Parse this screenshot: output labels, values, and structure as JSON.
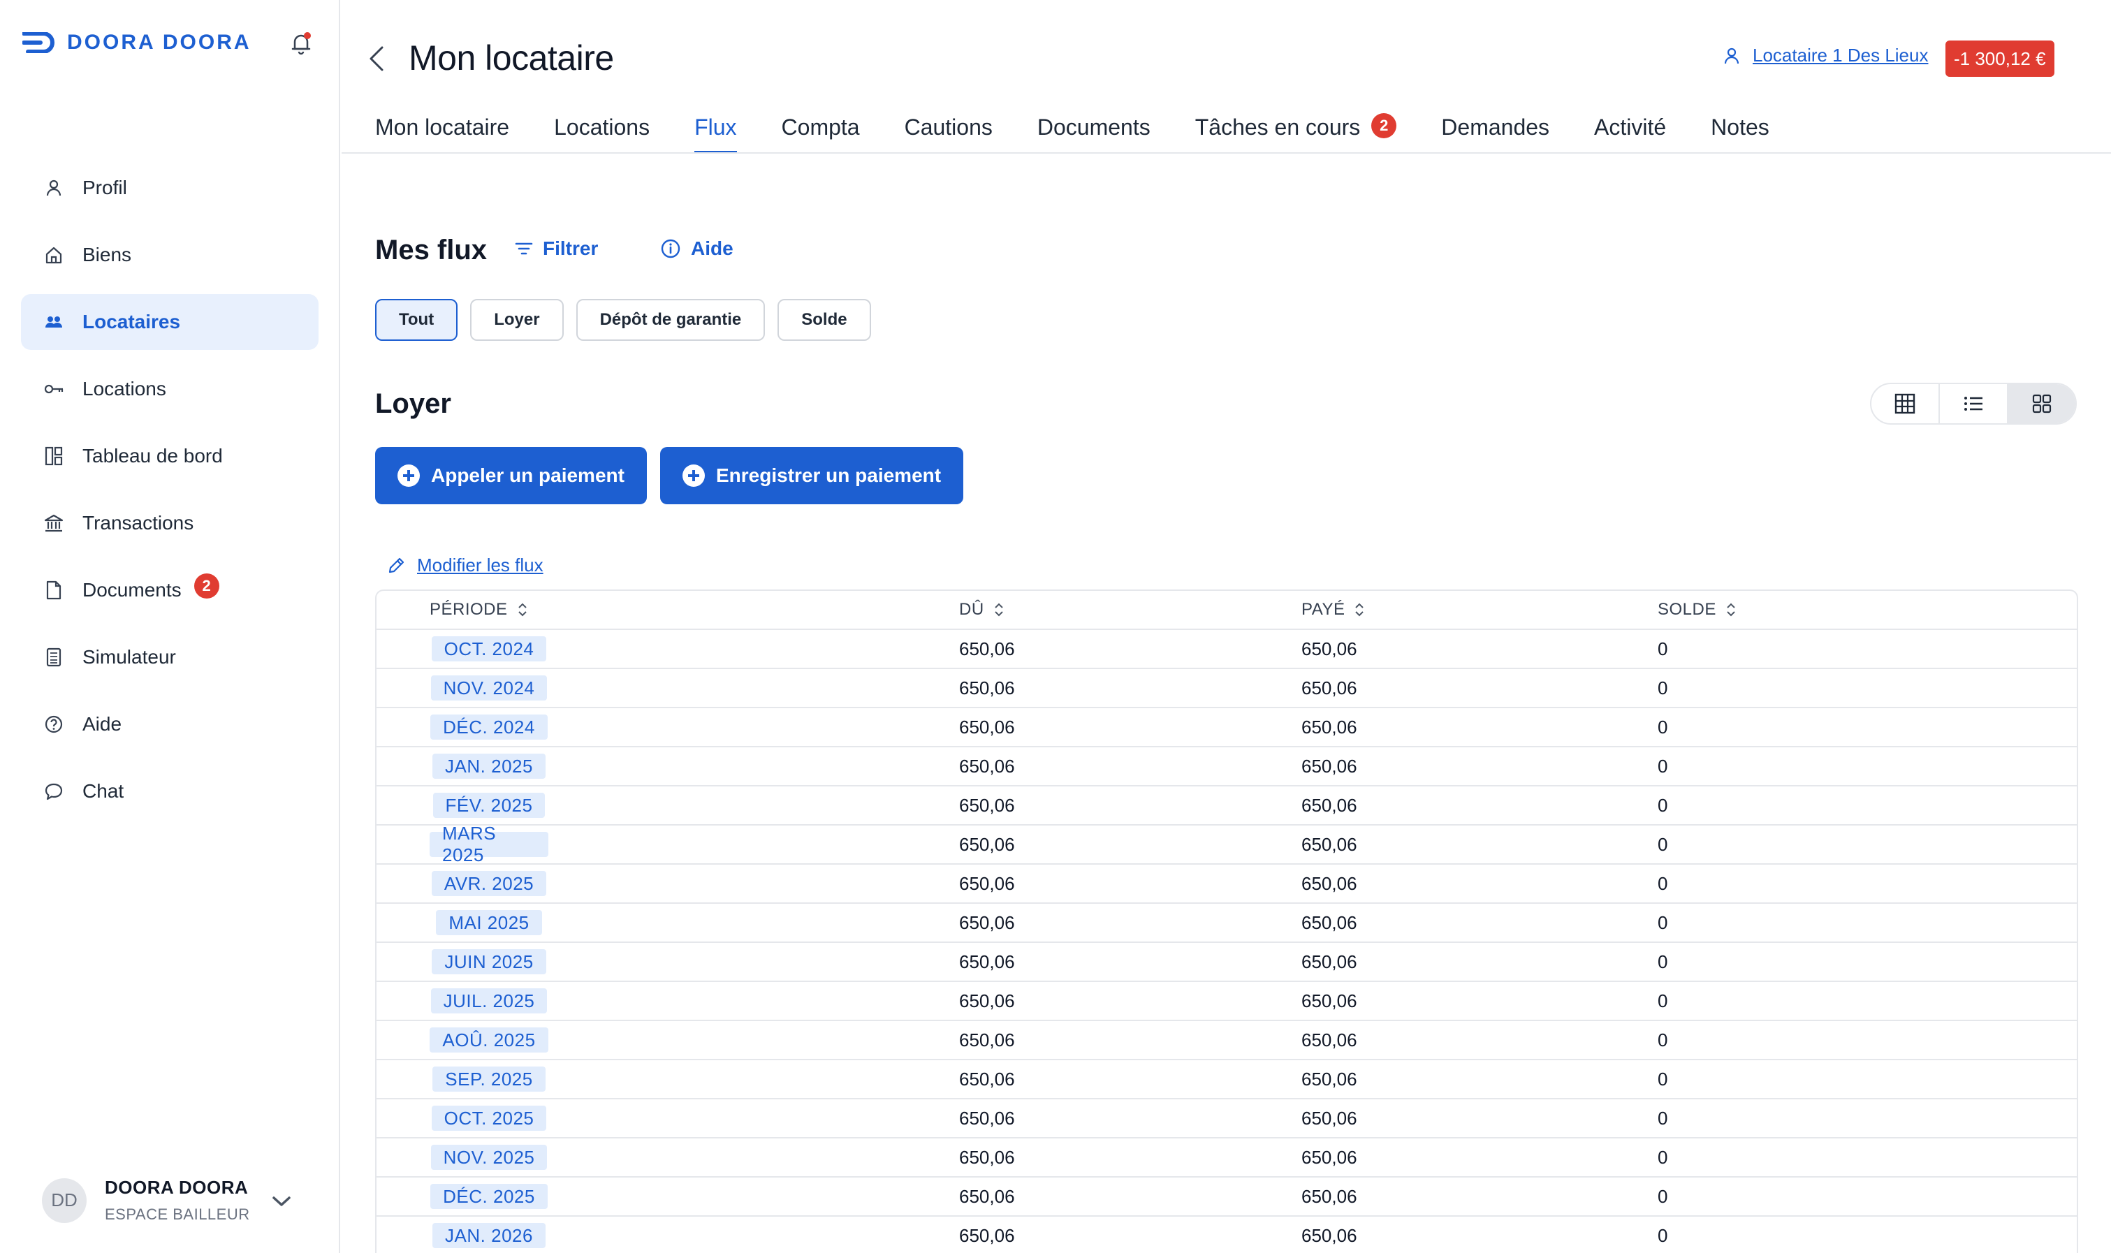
{
  "brand": {
    "name": "DOORA DOORA",
    "color": "#1d5fd1"
  },
  "sidebar": {
    "items": [
      {
        "label": "Profil",
        "icon": "user-icon",
        "active": false
      },
      {
        "label": "Biens",
        "icon": "home-icon",
        "active": false
      },
      {
        "label": "Locataires",
        "icon": "users-icon",
        "active": true
      },
      {
        "label": "Locations",
        "icon": "key-icon",
        "active": false
      },
      {
        "label": "Tableau de bord",
        "icon": "dashboard-icon",
        "active": false
      },
      {
        "label": "Transactions",
        "icon": "bank-icon",
        "active": false
      },
      {
        "label": "Documents",
        "icon": "document-icon",
        "active": false,
        "badge": "2"
      },
      {
        "label": "Simulateur",
        "icon": "calculator-icon",
        "active": false
      },
      {
        "label": "Aide",
        "icon": "help-icon",
        "active": false
      },
      {
        "label": "Chat",
        "icon": "chat-icon",
        "active": false
      }
    ],
    "user": {
      "initials": "DD",
      "name": "DOORA DOORA",
      "role": "ESPACE BAILLEUR"
    }
  },
  "header": {
    "title": "Mon locataire",
    "tenant_link": "Locataire 1 Des Lieux",
    "balance": "-1 300,12 €"
  },
  "tabs": [
    {
      "label": "Mon locataire",
      "active": false
    },
    {
      "label": "Locations",
      "active": false
    },
    {
      "label": "Flux",
      "active": true
    },
    {
      "label": "Compta",
      "active": false
    },
    {
      "label": "Cautions",
      "active": false
    },
    {
      "label": "Documents",
      "active": false
    },
    {
      "label": "Tâches en cours",
      "active": false,
      "badge": "2"
    },
    {
      "label": "Demandes",
      "active": false
    },
    {
      "label": "Activité",
      "active": false
    },
    {
      "label": "Notes",
      "active": false
    }
  ],
  "flux": {
    "title": "Mes flux",
    "filter_label": "Filtrer",
    "help_label": "Aide",
    "chips": [
      {
        "label": "Tout",
        "active": true
      },
      {
        "label": "Loyer",
        "active": false
      },
      {
        "label": "Dépôt de garantie",
        "active": false
      },
      {
        "label": "Solde",
        "active": false
      }
    ],
    "section_title": "Loyer",
    "buttons": {
      "call_payment": "Appeler un paiement",
      "record_payment": "Enregistrer un paiement"
    },
    "edit_link": "Modifier les flux",
    "view_toggle": [
      "table-view-icon",
      "list-view-icon",
      "grid-view-icon"
    ]
  },
  "table": {
    "columns": [
      "PÉRIODE",
      "DÛ",
      "PAYÉ",
      "SOLDE"
    ],
    "rows": [
      {
        "period": "OCT. 2024",
        "du": "650,06",
        "paye": "650,06",
        "solde": "0"
      },
      {
        "period": "NOV. 2024",
        "du": "650,06",
        "paye": "650,06",
        "solde": "0"
      },
      {
        "period": "DÉC. 2024",
        "du": "650,06",
        "paye": "650,06",
        "solde": "0"
      },
      {
        "period": "JAN. 2025",
        "du": "650,06",
        "paye": "650,06",
        "solde": "0"
      },
      {
        "period": "FÉV. 2025",
        "du": "650,06",
        "paye": "650,06",
        "solde": "0"
      },
      {
        "period": "MARS 2025",
        "du": "650,06",
        "paye": "650,06",
        "solde": "0"
      },
      {
        "period": "AVR. 2025",
        "du": "650,06",
        "paye": "650,06",
        "solde": "0"
      },
      {
        "period": "MAI 2025",
        "du": "650,06",
        "paye": "650,06",
        "solde": "0"
      },
      {
        "period": "JUIN 2025",
        "du": "650,06",
        "paye": "650,06",
        "solde": "0"
      },
      {
        "period": "JUIL. 2025",
        "du": "650,06",
        "paye": "650,06",
        "solde": "0"
      },
      {
        "period": "AOÛ. 2025",
        "du": "650,06",
        "paye": "650,06",
        "solde": "0"
      },
      {
        "period": "SEP. 2025",
        "du": "650,06",
        "paye": "650,06",
        "solde": "0"
      },
      {
        "period": "OCT. 2025",
        "du": "650,06",
        "paye": "650,06",
        "solde": "0"
      },
      {
        "period": "NOV. 2025",
        "du": "650,06",
        "paye": "650,06",
        "solde": "0"
      },
      {
        "period": "DÉC. 2025",
        "du": "650,06",
        "paye": "650,06",
        "solde": "0"
      },
      {
        "period": "JAN. 2026",
        "du": "650,06",
        "paye": "650,06",
        "solde": "0"
      }
    ]
  }
}
